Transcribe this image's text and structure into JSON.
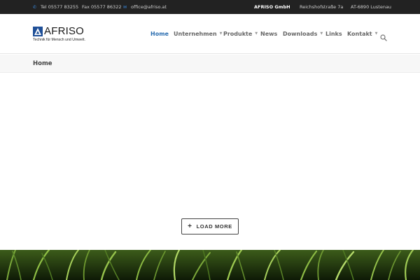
{
  "topbar": {
    "phone": "Tel 05577 83255",
    "fax": "Fax 05577 86322",
    "email": "office@afriso.at",
    "company": "AFRISO GmbH",
    "street": "Reichshofstraße 7a",
    "city": "AT-6890 Lustenau"
  },
  "logo": {
    "name": "AFRISO",
    "tagline": "Technik für Mensch und Umwelt."
  },
  "nav": {
    "items": [
      {
        "label": "Home",
        "active": true
      },
      {
        "label": "Unternehmen",
        "has_dropdown": true
      },
      {
        "label": "Produkte",
        "has_dropdown": true
      },
      {
        "label": "News"
      },
      {
        "label": "Downloads",
        "has_dropdown": true
      },
      {
        "label": "Links"
      },
      {
        "label": "Kontakt",
        "has_dropdown": true
      }
    ]
  },
  "breadcrumb": {
    "title": "Home"
  },
  "load_more": {
    "label": "LOAD MORE"
  },
  "colors": {
    "accent": "#2a6db0",
    "topbar_bg": "#222222",
    "logo_blue": "#1f4f97"
  }
}
